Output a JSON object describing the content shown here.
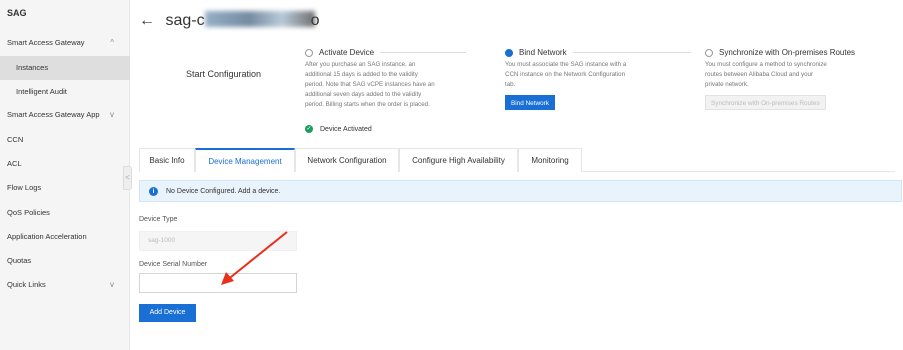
{
  "sidebar": {
    "title": "SAG",
    "items": [
      {
        "label": "Smart Access Gateway",
        "chevron": "^"
      },
      {
        "label": "Instances"
      },
      {
        "label": "Intelligent Audit"
      },
      {
        "label": "Smart Access Gateway App",
        "chevron": "v"
      },
      {
        "label": "CCN"
      },
      {
        "label": "ACL"
      },
      {
        "label": "Flow Logs"
      },
      {
        "label": "QoS Policies"
      },
      {
        "label": "Application Acceleration"
      },
      {
        "label": "Quotas"
      },
      {
        "label": "Quick Links",
        "chevron": "v"
      }
    ],
    "collapse_glyph": "<"
  },
  "header": {
    "back_glyph": "←",
    "title_prefix": "sag-c",
    "title_suffix": "o"
  },
  "config": {
    "label": "Start Configuration",
    "steps": [
      {
        "title": "Activate Device",
        "desc": [
          "After you purchase an SAG instance, an",
          "additional 15 days is added to the validity",
          "period. Note that SAG vCPE instances have an",
          "additional seven days added to the validity",
          "period. Billing starts when the order is placed."
        ],
        "status": "Device Activated"
      },
      {
        "title": "Bind Network",
        "desc": [
          "You must associate the SAG instance with a",
          "CCN instance on the Network Configuration",
          "tab."
        ],
        "button": "Bind Network"
      },
      {
        "title": "Synchronize with On-premises Routes",
        "desc": [
          "You must configure a method to synchronize",
          "routes between Alibaba Cloud and your",
          "private network."
        ],
        "button": "Synchronize with On-premises Routes"
      }
    ]
  },
  "tabs": [
    "Basic Info",
    "Device Management",
    "Network Configuration",
    "Configure High Availability",
    "Monitoring"
  ],
  "info": {
    "icon": "i",
    "text": "No Device Configured. Add a device."
  },
  "form": {
    "device_type_label": "Device Type",
    "device_type_value": "sag-1000",
    "serial_label": "Device Serial Number",
    "serial_value": "",
    "add_button": "Add Device"
  },
  "colors": {
    "accent": "#1a6fd4",
    "annotation_arrow": "#e8301c",
    "success": "#1e9e5a"
  }
}
